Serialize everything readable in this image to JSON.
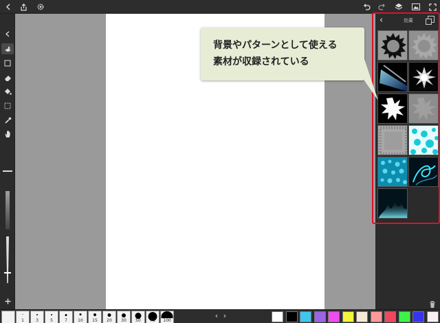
{
  "topbar": {
    "left_icons": [
      "back-icon",
      "share-icon",
      "gear-icon"
    ],
    "right_icons": [
      "undo-icon",
      "redo-icon",
      "layers-icon",
      "image-icon",
      "fullscreen-icon"
    ]
  },
  "tools": [
    "collapse-icon",
    "layer-brush-icon",
    "rectangle-icon",
    "eraser-icon",
    "fill-bucket-icon",
    "selection-icon",
    "eyedropper-icon",
    "hand-icon",
    "plus-icon"
  ],
  "panel": {
    "title": "効果",
    "tiles": [
      "starburst-dark",
      "starburst-light",
      "blue-light-ray",
      "spark-white",
      "explosion-white",
      "explosion-faint",
      "frame-texture",
      "cyan-pattern",
      "bubbles-cyan",
      "swirl-cyan",
      "blue-flame",
      "empty"
    ]
  },
  "callout": {
    "line1": "背景やパターンとして使える",
    "line2": "素材が収録されている"
  },
  "brushes": [
    "1",
    "3",
    "5",
    "7",
    "10",
    "15",
    "20",
    "30",
    "50",
    "75",
    "100"
  ],
  "swatches": [
    "#ffffff",
    "#000000",
    "#3ec6f0",
    "#9b63e6",
    "#f04cf0",
    "#f5f53c",
    "#f6e8d6",
    "#fb9a98",
    "#f2455e",
    "#3cf34a",
    "#3535f0",
    "#f7f0f7"
  ]
}
